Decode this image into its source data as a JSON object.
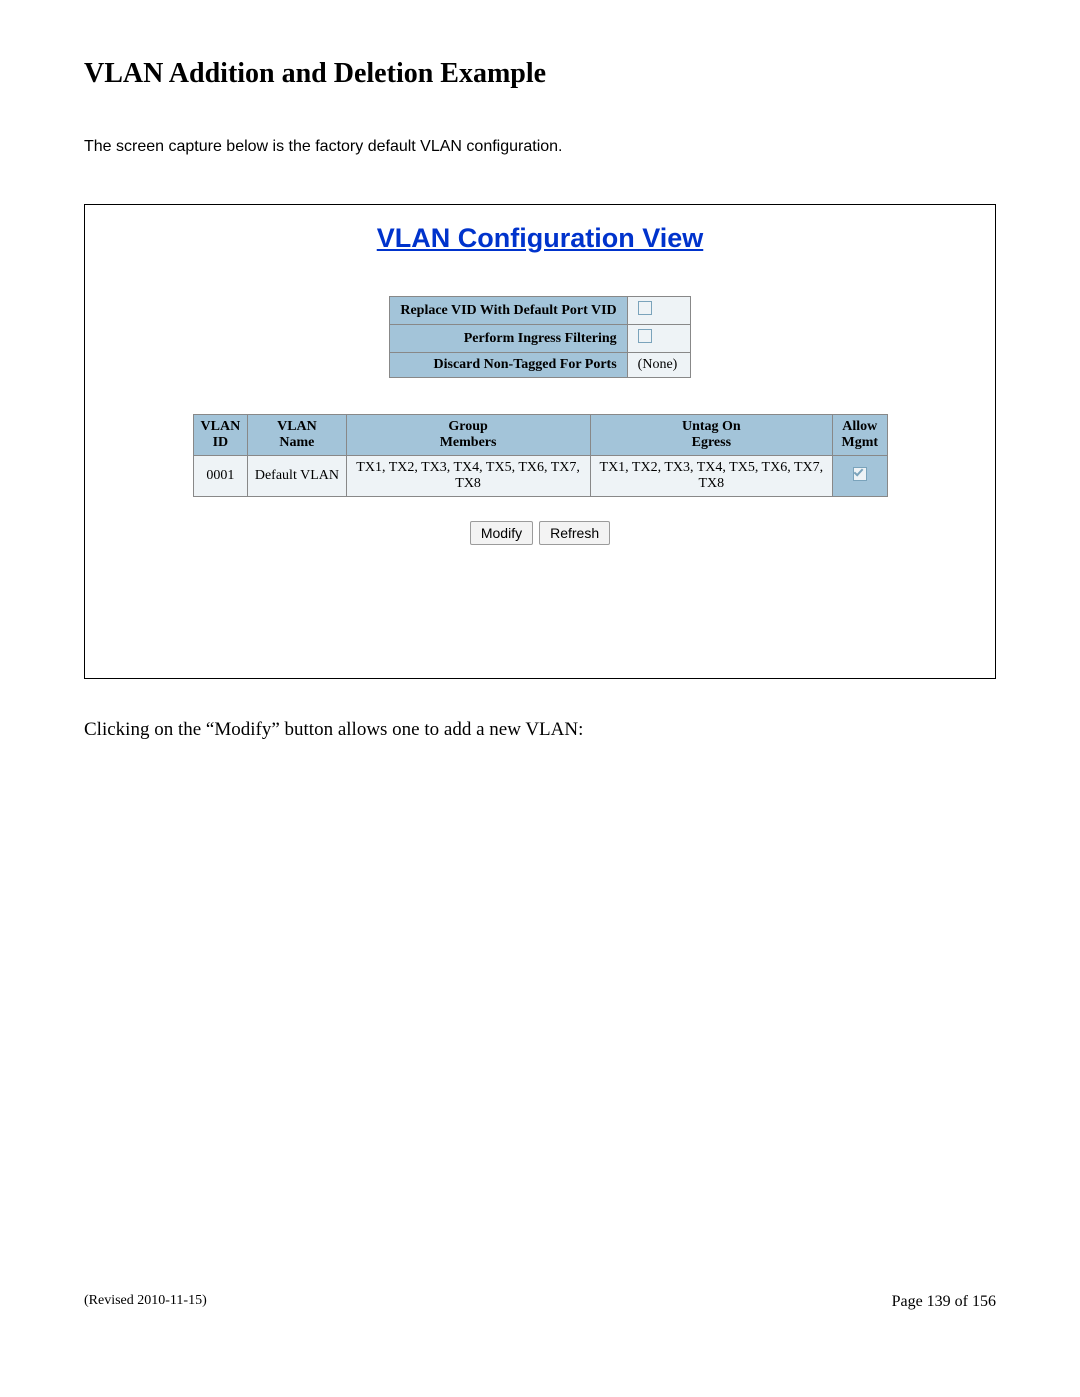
{
  "doc": {
    "title": "VLAN Addition and Deletion Example",
    "intro": "The screen capture below is the factory default VLAN configuration.",
    "outtro": "Clicking on the “Modify” button allows one to add a new VLAN:",
    "revised": "(Revised 2010-11-15)",
    "page_label": "Page 139 of 156"
  },
  "screenshot": {
    "title": "VLAN Configuration View",
    "settings": {
      "replace_vid_label": "Replace VID With Default Port VID",
      "ingress_label": "Perform Ingress Filtering",
      "discard_label": "Discard Non-Tagged For Ports",
      "discard_value": "(None)"
    },
    "columns": {
      "id": "VLAN ID",
      "name": "VLAN Name",
      "group": "Group Members",
      "untag": "Untag On Egress",
      "allow": "Allow Mgmt"
    },
    "row": {
      "id": "0001",
      "name": "Default VLAN",
      "group": "TX1, TX2, TX3, TX4, TX5, TX6, TX7, TX8",
      "untag": "TX1, TX2, TX3, TX4, TX5, TX6, TX7, TX8"
    },
    "buttons": {
      "modify": "Modify",
      "refresh": "Refresh"
    }
  }
}
